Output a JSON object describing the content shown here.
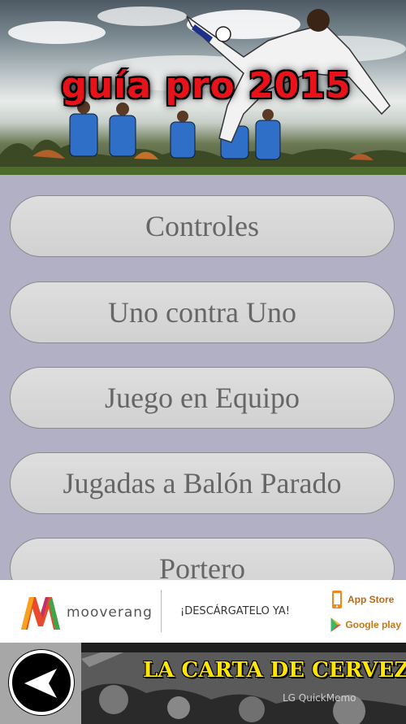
{
  "header": {
    "title": "guía pro 2015"
  },
  "menu": {
    "items": [
      {
        "label": "Controles"
      },
      {
        "label": "Uno contra Uno"
      },
      {
        "label": "Juego en Equipo"
      },
      {
        "label": "Jugadas a Balón Parado"
      },
      {
        "label": "Portero"
      }
    ]
  },
  "ad": {
    "brand": "mooverang",
    "cta": "¡DESCÁRGATELO YA!",
    "stores": {
      "apple": "App Store",
      "google": "Google play"
    }
  },
  "bottom": {
    "back_icon": "back-arrow-icon",
    "banner_title": "LA CARTA DE CERVEZA",
    "watermark": "LG QuickMemo"
  },
  "colors": {
    "background": "#b2b0c5",
    "button_fill": "#d6d6d6",
    "button_text": "#666666",
    "title_red": "#e8131a",
    "banner_yellow": "#ffe600"
  }
}
